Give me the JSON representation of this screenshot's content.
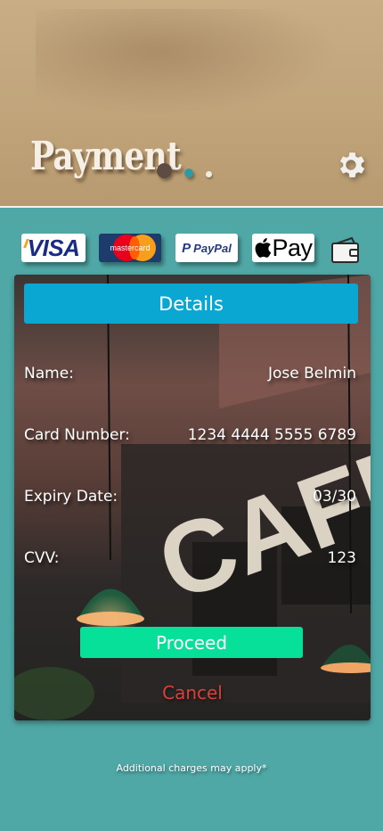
{
  "header": {
    "title": "Payment",
    "settings_icon": "gear-icon"
  },
  "payment_methods": [
    {
      "name": "visa",
      "label": "VISA"
    },
    {
      "name": "mastercard",
      "label": "mastercard"
    },
    {
      "name": "paypal",
      "label": "PayPal"
    },
    {
      "name": "apple-pay",
      "label": "Pay"
    },
    {
      "name": "wallet",
      "icon": "wallet-icon"
    }
  ],
  "details": {
    "button_label": "Details",
    "fields": [
      {
        "label": "Name:",
        "value": "Jose Belmin"
      },
      {
        "label": "Card Number:",
        "value": "1234 4444 5555 6789"
      },
      {
        "label": "Expiry Date:",
        "value": "03/30"
      },
      {
        "label": "CVV:",
        "value": "123"
      }
    ]
  },
  "actions": {
    "proceed_label": "Proceed",
    "cancel_label": "Cancel"
  },
  "footer": {
    "note": "Additional charges may apply*"
  },
  "colors": {
    "header_bg": "#c1a47a",
    "body_bg": "#4fa8a6",
    "details_button": "#0ba7d3",
    "proceed_button": "#07e098",
    "cancel_text": "#d9413a"
  }
}
